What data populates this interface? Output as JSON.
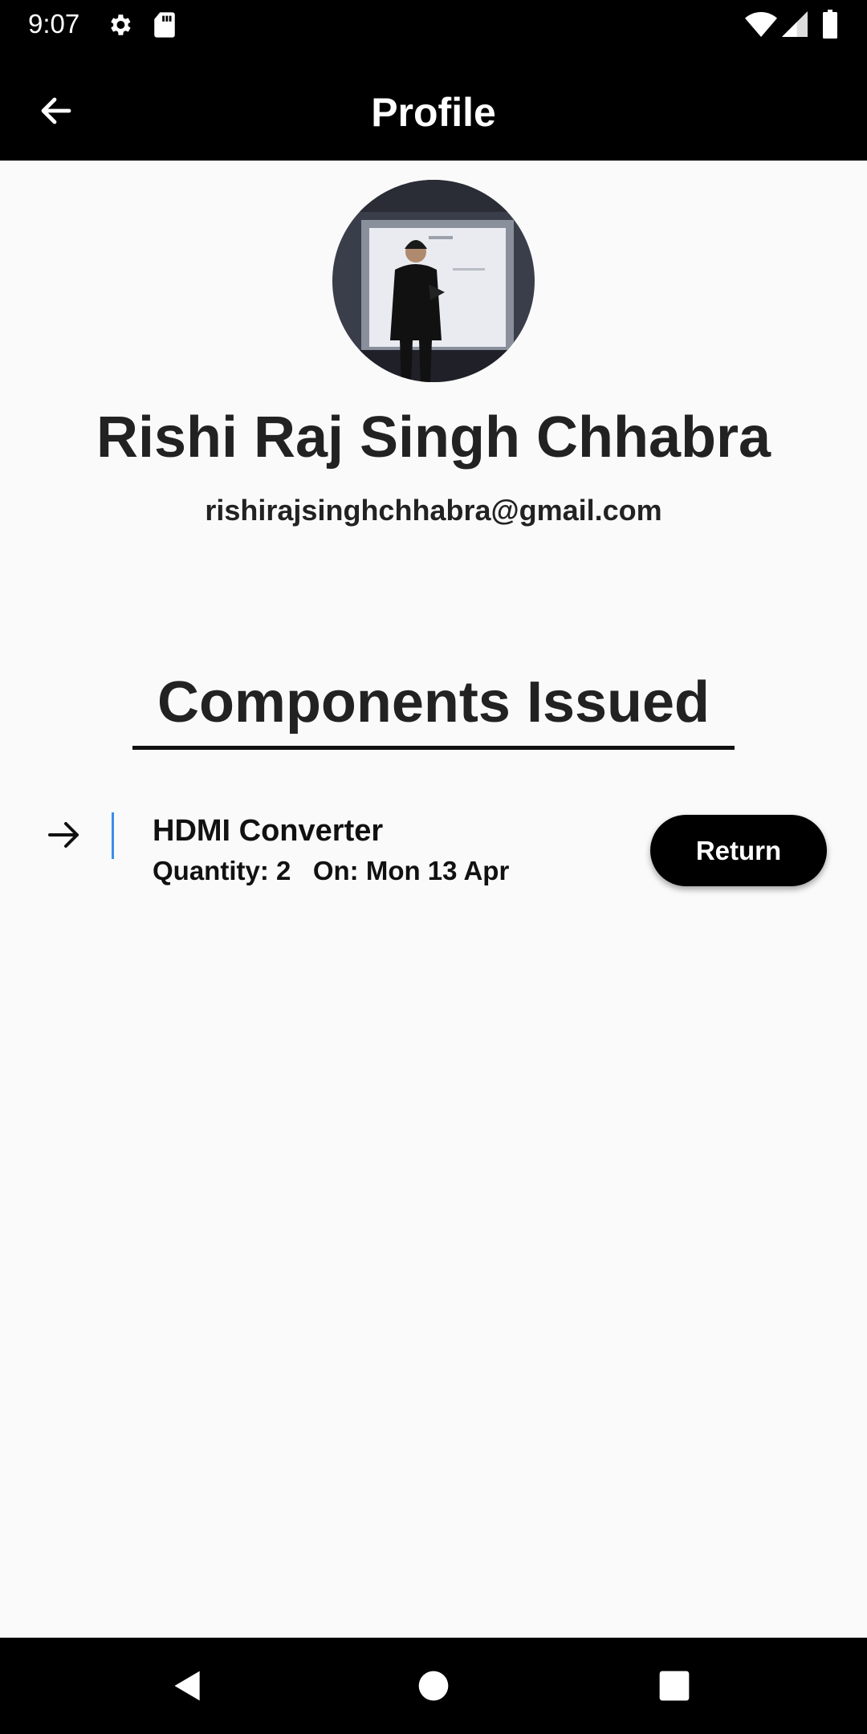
{
  "status_bar": {
    "time": "9:07",
    "icons": [
      "gear-icon",
      "sd-card-icon",
      "wifi-icon",
      "cell-signal-icon",
      "battery-icon"
    ]
  },
  "app_bar": {
    "title": "Profile",
    "back_icon": "arrow-back-icon"
  },
  "profile": {
    "name": "Rishi Raj Singh Chhabra",
    "email": "rishirajsinghchhabra@gmail.com"
  },
  "components": {
    "heading": "Components Issued",
    "items": [
      {
        "name": "HDMI Converter",
        "details": "Quantity: 2   On: Mon 13 Apr",
        "action_label": "Return"
      }
    ]
  },
  "nav_bar": {
    "buttons": [
      "back-triangle-icon",
      "home-circle-icon",
      "recents-square-icon"
    ]
  },
  "colors": {
    "app_bar_bg": "#000000",
    "page_bg": "#fafafa",
    "accent_divider": "#3a8ee6",
    "button_bg": "#000000"
  }
}
